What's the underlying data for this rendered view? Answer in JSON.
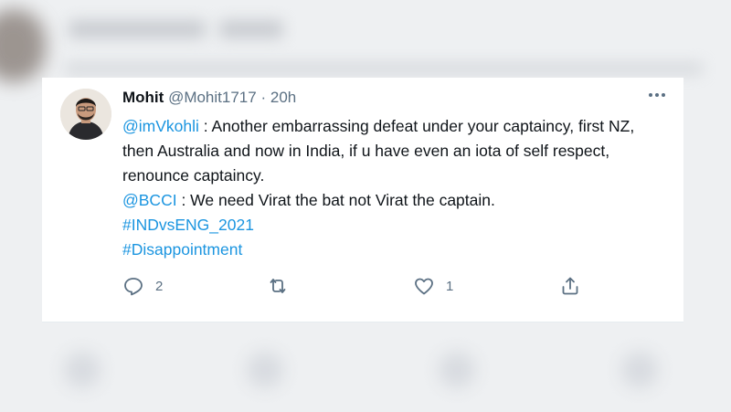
{
  "tweet": {
    "display_name": "Mohit",
    "handle": "@Mohit1717",
    "separator": "·",
    "time": "20h",
    "more_icon": "more-horizontal-icon",
    "lines": [
      {
        "mention": "@imVkohli",
        "text": " : Another embarrassing defeat under your captaincy, first NZ,"
      },
      {
        "text": "then Australia and now in India, if u have even an iota of self respect,"
      },
      {
        "text": "renounce captaincy."
      },
      {
        "mention": "@BCCI",
        "text": " : We need Virat the bat not Virat the captain."
      }
    ],
    "hashtags": [
      "#INDvsENG_2021",
      "#Disappointment"
    ],
    "actions": {
      "reply_count": "2",
      "retweet_count": "",
      "like_count": "1"
    },
    "link_color": "#1b95e0",
    "text_color": "#0f1419",
    "muted_color": "#5b7083"
  }
}
